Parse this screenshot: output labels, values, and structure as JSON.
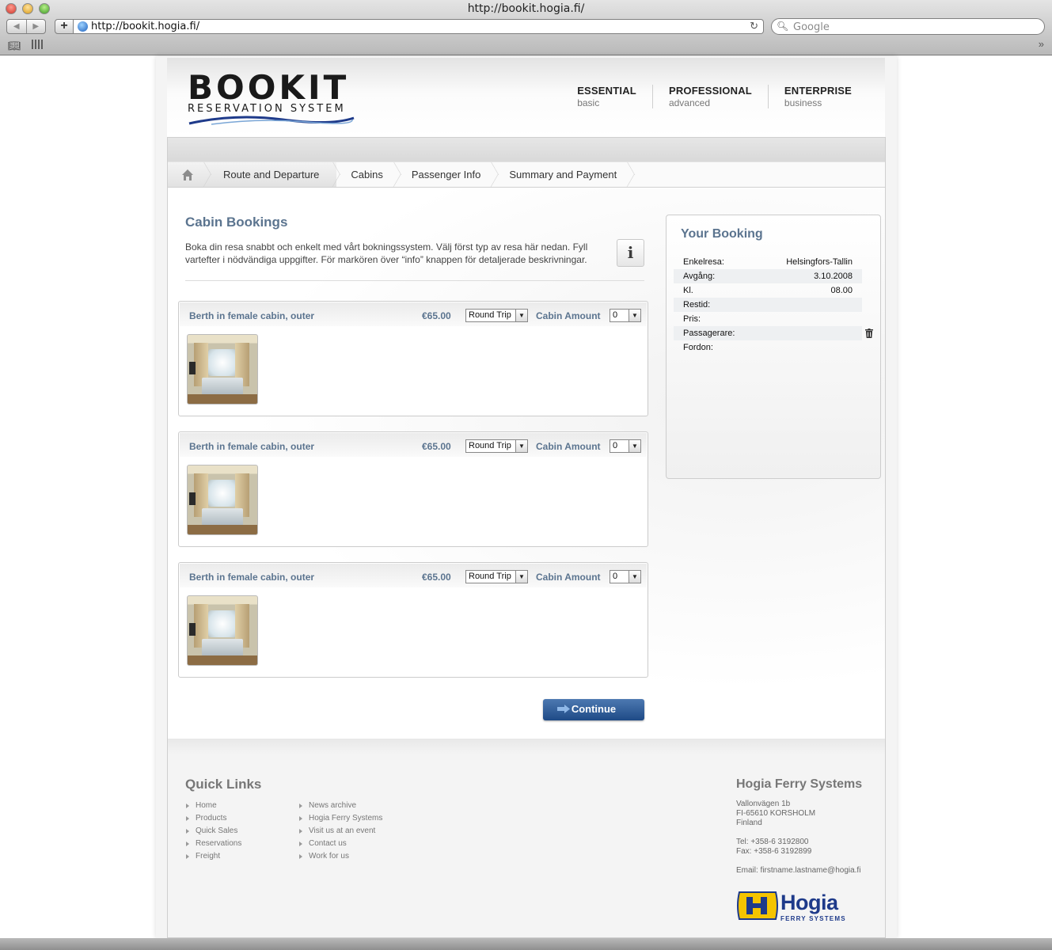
{
  "browser": {
    "window_title": "http://bookit.hogia.fi/",
    "url": "http://bookit.hogia.fi/",
    "search_placeholder": "Google"
  },
  "header": {
    "logo_main": "BOOKIT",
    "logo_sub": "RESERVATION SYSTEM",
    "editions": [
      {
        "name": "ESSENTIAL",
        "sub": "basic"
      },
      {
        "name": "PROFESSIONAL",
        "sub": "advanced"
      },
      {
        "name": "ENTERPRISE",
        "sub": "business"
      }
    ]
  },
  "steps": [
    "Route and Departure",
    "Cabins",
    "Passenger Info",
    "Summary and Payment"
  ],
  "cabin_bookings": {
    "title": "Cabin Bookings",
    "intro": "Boka din resa snabbt och enkelt med vårt bokningssystem. Välj först typ av resa här nedan. Fyll vartefter i nödvändiga uppgifter. För markören över “info” knappen för detaljerade beskrivningar.",
    "info_label": "i",
    "amount_label": "Cabin Amount",
    "cabins": [
      {
        "name": "Berth in female cabin, outer",
        "price": "€65.00",
        "trip": "Round Trip",
        "amount": "0"
      },
      {
        "name": "Berth in female cabin, outer",
        "price": "€65.00",
        "trip": "Round Trip",
        "amount": "0"
      },
      {
        "name": "Berth in female cabin, outer",
        "price": "€65.00",
        "trip": "Round Trip",
        "amount": "0"
      }
    ],
    "continue_label": "Continue"
  },
  "your_booking": {
    "title": "Your Booking",
    "rows": [
      {
        "label": "Enkelresa:",
        "value": "Helsingfors-Tallin"
      },
      {
        "label": "Avgång:",
        "value": "3.10.2008"
      },
      {
        "label": "Kl.",
        "value": "08.00"
      },
      {
        "label": "Restid:",
        "value": ""
      },
      {
        "label": "Pris:",
        "value": ""
      },
      {
        "label": "Passagerare:",
        "value": ""
      },
      {
        "label": "Fordon:",
        "value": ""
      }
    ]
  },
  "footer": {
    "quick_links_title": "Quick Links",
    "links_col1": [
      "Home",
      "Products",
      "Quick Sales",
      "Reservations",
      "Freight"
    ],
    "links_col2": [
      "News archive",
      "Hogia Ferry Systems",
      "Visit us at an event",
      "Contact us",
      "Work for us"
    ],
    "company": {
      "title": "Hogia Ferry Systems",
      "address1": "Vallonvägen 1b",
      "address2": "FI-65610 KORSHOLM",
      "country": "Finland",
      "tel": "Tel: +358-6 3192800",
      "fax": "Fax: +358-6 3192899",
      "email": "Email: firstname.lastname@hogia.fi"
    },
    "hogia_logo": {
      "word": "Hogia",
      "sub": "FERRY SYSTEMS"
    }
  },
  "colors": {
    "heading_blue": "#5b748f",
    "button_blue": "#1e4a86"
  }
}
